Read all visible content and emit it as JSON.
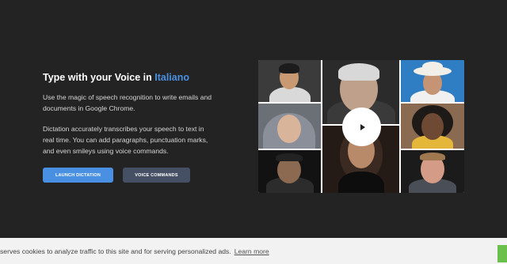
{
  "hero": {
    "headline_prefix": "Type with your Voice in ",
    "headline_language": "Italiano",
    "paragraph1": "Use the magic of speech recognition to write emails and documents in Google Chrome.",
    "paragraph2": "Dictation accurately transcribes your speech to text in real time. You can add paragraphs, punctuation marks, and even smileys using voice commands.",
    "launch_button": "LAUNCH DICTATION",
    "voice_commands_button": "VOICE COMMANDS"
  },
  "video": {
    "play_icon": "play-icon"
  },
  "cookie_banner": {
    "text": "serves cookies to analyze traffic to this site and for serving personalized ads.",
    "link": "Learn more"
  },
  "colors": {
    "background": "#232323",
    "accent": "#4a90e2",
    "secondary_button": "#465064",
    "cookie_bg": "#f2f2f2",
    "accept": "#6bc04b"
  }
}
